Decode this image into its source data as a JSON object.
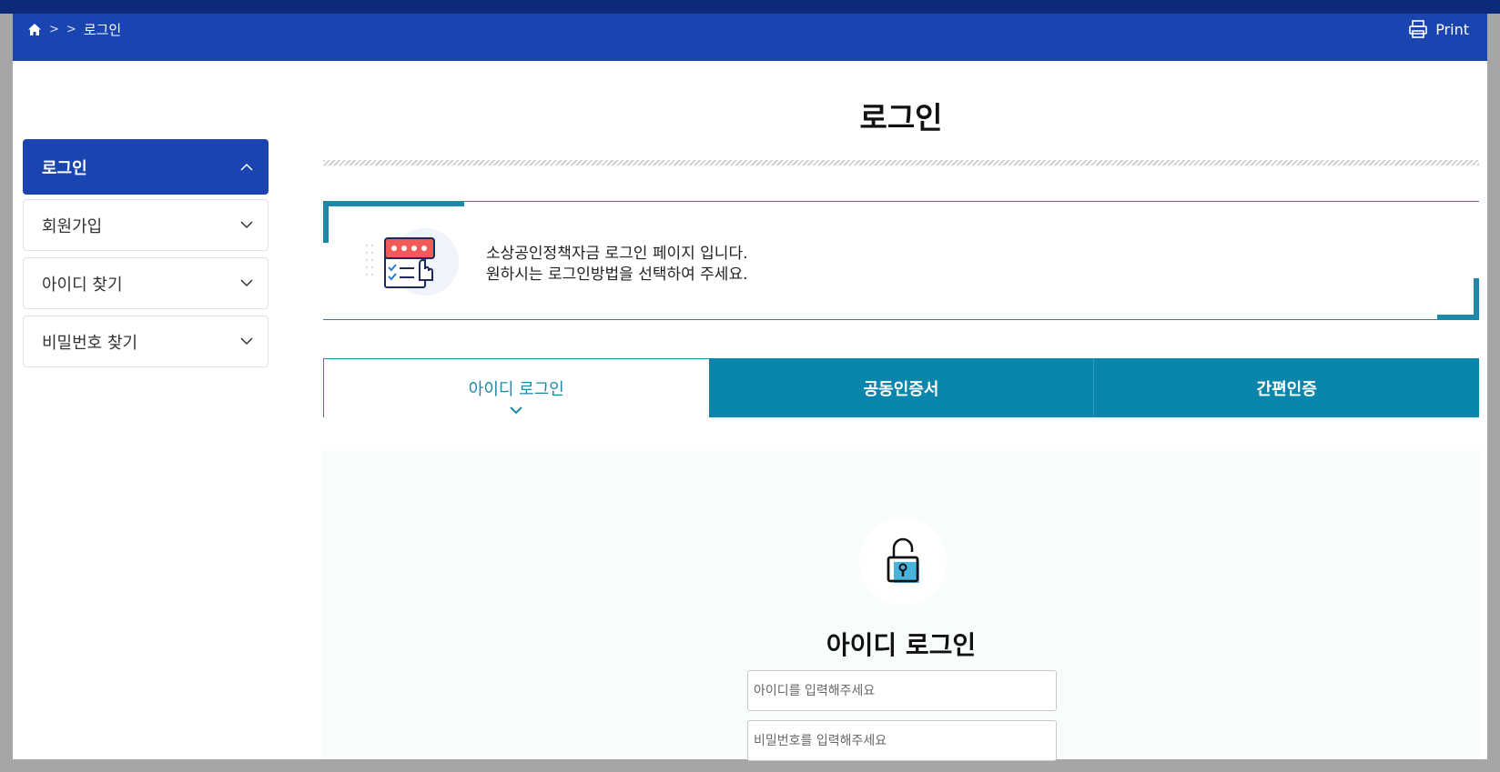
{
  "breadcrumb": {
    "current": "로그인",
    "separator": ">"
  },
  "header": {
    "print_label": "Print"
  },
  "sidebar": {
    "items": [
      {
        "label": "로그인",
        "active": true
      },
      {
        "label": "회원가입"
      },
      {
        "label": "아이디 찾기"
      },
      {
        "label": "비밀번호 찾기"
      }
    ]
  },
  "main": {
    "title": "로그인",
    "intro_line1": "소상공인정책자금 로그인 페이지 입니다.",
    "intro_line2": "원하시는 로그인방법을 선택하여 주세요.",
    "tabs": [
      {
        "label": "아이디 로그인",
        "active": true
      },
      {
        "label": "공동인증서"
      },
      {
        "label": "간편인증"
      }
    ],
    "login": {
      "title": "아이디 로그인",
      "id_placeholder": "아이디를 입력해주세요",
      "pw_placeholder": "비밀번호를 입력해주세요"
    }
  },
  "colors": {
    "header": "#1a45b0",
    "accent": "#1e88a8",
    "tab_dark": "#0a86ac"
  }
}
